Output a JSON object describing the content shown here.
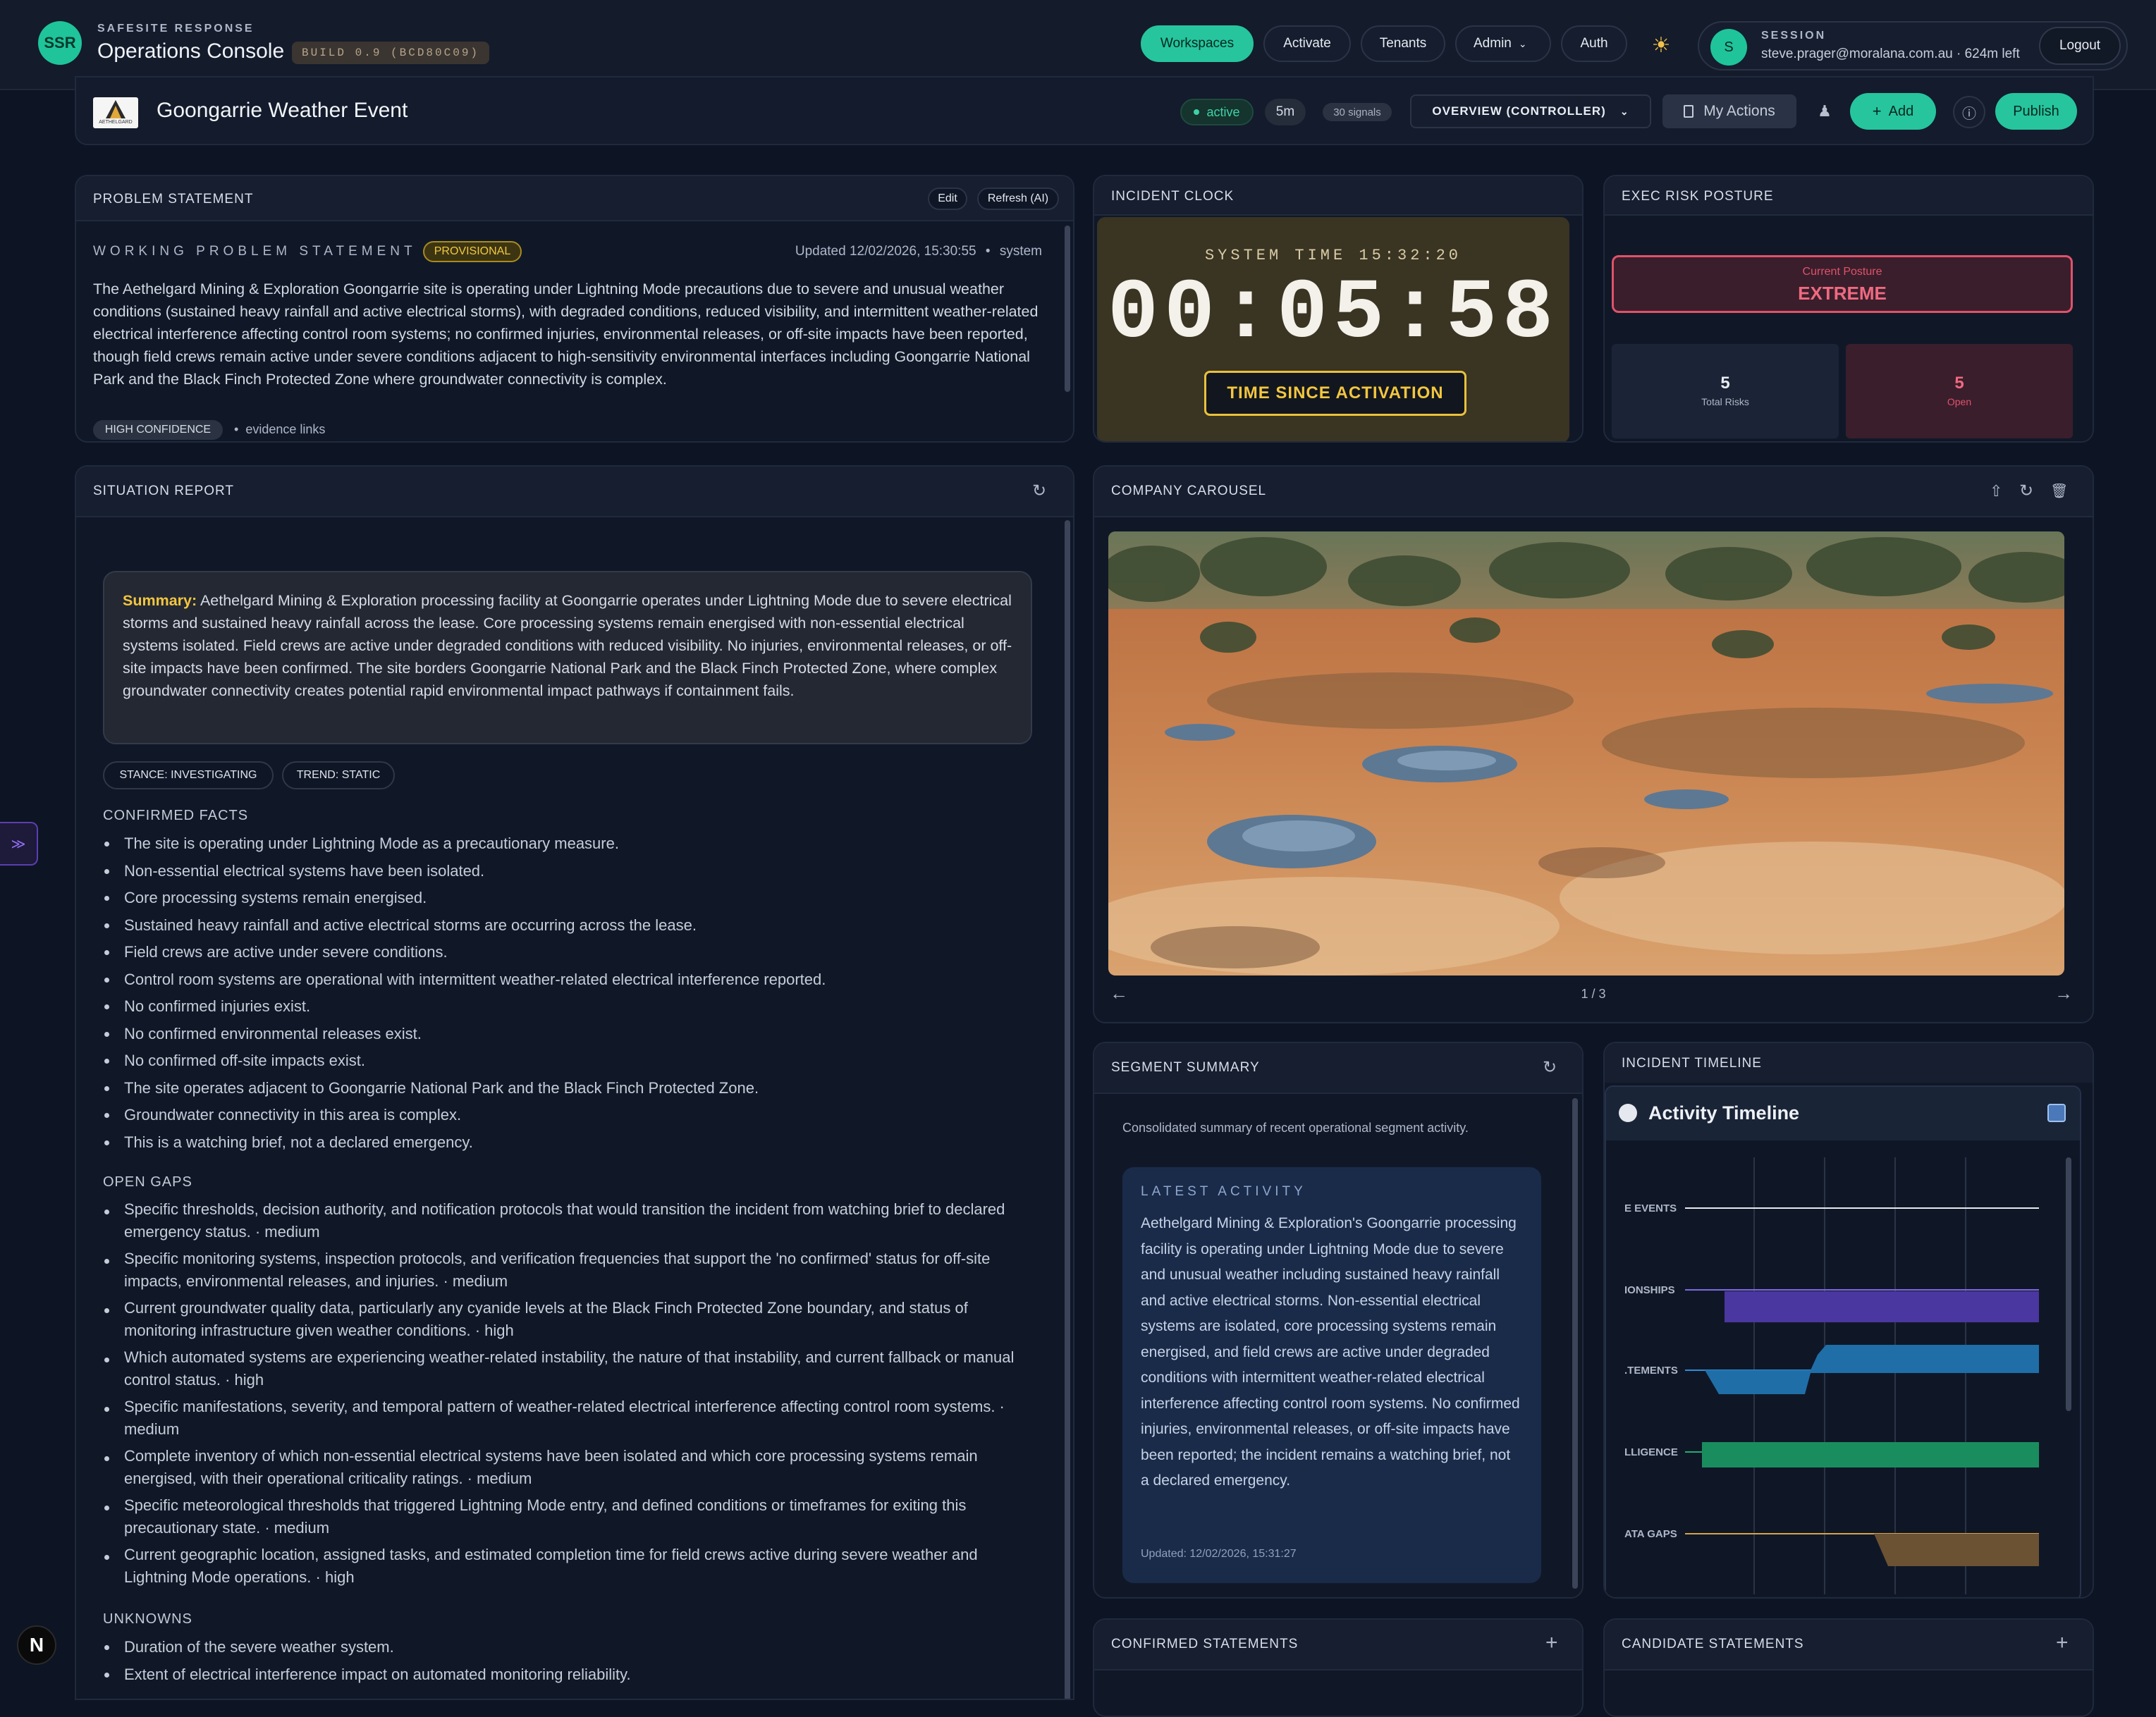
{
  "header": {
    "logo": "SSR",
    "subtitle": "SAFESITE RESPONSE",
    "title": "Operations Console",
    "build": "BUILD 0.9 (BCD80C09)",
    "nav": [
      "Workspaces",
      "Activate",
      "Tenants",
      "Admin",
      "Auth"
    ],
    "session_label": "SESSION",
    "session_user": "steve.prager@moralana.com.au · 624m left",
    "avatar": "S",
    "logout": "Logout"
  },
  "workspace": {
    "logo_text": "AETHELGARD",
    "title": "Goongarrie Weather Event",
    "status": "active",
    "duration": "5m",
    "signals": "30 signals",
    "view": "OVERVIEW (CONTROLLER)",
    "my_actions": "My Actions",
    "add": "Add",
    "publish": "Publish"
  },
  "problem": {
    "card_title": "PROBLEM STATEMENT",
    "edit": "Edit",
    "refresh": "Refresh (AI)",
    "heading": "WORKING PROBLEM STATEMENT",
    "badge": "PROVISIONAL",
    "updated": "Updated 12/02/2026, 15:30:55",
    "author": "system",
    "text": "The Aethelgard Mining & Exploration Goongarrie site is operating under Lightning Mode precautions due to severe and unusual weather conditions (sustained heavy rainfall and active electrical storms), with degraded conditions, reduced visibility, and intermittent weather-related electrical interference affecting control room systems; no confirmed injuries, environmental releases, or off-site impacts have been reported, though field crews remain active under severe conditions adjacent to high-sensitivity environmental interfaces including Goongarrie National Park and the Black Finch Protected Zone where groundwater connectivity is complex.",
    "confidence": "HIGH CONFIDENCE",
    "evidence": "evidence links"
  },
  "clock": {
    "card_title": "INCIDENT CLOCK",
    "system_time": "SYSTEM TIME 15:32:20",
    "elapsed": "00:05:58",
    "label": "TIME SINCE ACTIVATION"
  },
  "risk": {
    "card_title": "EXEC RISK POSTURE",
    "posture_label": "Current Posture",
    "posture": "EXTREME",
    "total": "5",
    "total_label": "Total Risks",
    "open": "5",
    "open_label": "Open"
  },
  "sitrep": {
    "card_title": "SITUATION REPORT",
    "summary_label": "Summary:",
    "summary": "Aethelgard Mining & Exploration processing facility at Goongarrie operates under Lightning Mode due to severe electrical storms and sustained heavy rainfall across the lease. Core processing systems remain energised with non-essential electrical systems isolated. Field crews are active under degraded conditions with reduced visibility. No injuries, environmental releases, or off-site impacts have been confirmed. The site borders Goongarrie National Park and the Black Finch Protected Zone, where complex groundwater connectivity creates potential rapid environmental impact pathways if containment fails.",
    "stance": "STANCE: INVESTIGATING",
    "trend": "TREND: STATIC",
    "facts_title": "CONFIRMED FACTS",
    "facts": [
      "The site is operating under Lightning Mode as a precautionary measure.",
      "Non-essential electrical systems have been isolated.",
      "Core processing systems remain energised.",
      "Sustained heavy rainfall and active electrical storms are occurring across the lease.",
      "Field crews are active under severe conditions.",
      "Control room systems are operational with intermittent weather-related electrical interference reported.",
      "No confirmed injuries exist.",
      "No confirmed environmental releases exist.",
      "No confirmed off-site impacts exist.",
      "The site operates adjacent to Goongarrie National Park and the Black Finch Protected Zone.",
      "Groundwater connectivity in this area is complex.",
      "This is a watching brief, not a declared emergency."
    ],
    "gaps_title": "OPEN GAPS",
    "gaps": [
      "Specific thresholds, decision authority, and notification protocols that would transition the incident from watching brief to declared emergency status. · medium",
      "Specific monitoring systems, inspection protocols, and verification frequencies that support the 'no confirmed' status for off-site impacts, environmental releases, and injuries. · medium",
      "Current groundwater quality data, particularly any cyanide levels at the Black Finch Protected Zone boundary, and status of monitoring infrastructure given weather conditions. · high",
      "Which automated systems are experiencing weather-related instability, the nature of that instability, and current fallback or manual control status. · high",
      "Specific manifestations, severity, and temporal pattern of weather-related electrical interference affecting control room systems. · medium",
      "Complete inventory of which non-essential electrical systems have been isolated and which core processing systems remain energised, with their operational criticality ratings. · medium",
      "Specific meteorological thresholds that triggered Lightning Mode entry, and defined conditions or timeframes for exiting this precautionary state. · medium",
      "Current geographic location, assigned tasks, and estimated completion time for field crews active during severe weather and Lightning Mode operations. · high"
    ],
    "unknowns_title": "UNKNOWNS",
    "unknowns": [
      "Duration of the severe weather system.",
      "Extent of electrical interference impact on automated monitoring reliability."
    ]
  },
  "carousel": {
    "card_title": "COMPANY CAROUSEL",
    "counter": "1 / 3"
  },
  "segment": {
    "card_title": "SEGMENT SUMMARY",
    "intro": "Consolidated summary of recent operational segment activity.",
    "latest_label": "LATEST ACTIVITY",
    "text": "Aethelgard Mining & Exploration's Goongarrie processing facility is operating under Lightning Mode due to severe and unusual weather including sustained heavy rainfall and active electrical storms. Non-essential electrical systems are isolated, core processing systems remain energised, and field crews are active under degraded conditions with intermittent weather-related electrical interference affecting control room systems. No confirmed injuries, environmental releases, or off-site impacts have been reported; the incident remains a watching brief, not a declared emergency.",
    "updated": "Updated: 12/02/2026, 15:31:27"
  },
  "timeline": {
    "card_title": "INCIDENT TIMELINE",
    "heading": "Activity Timeline",
    "rows": [
      "E EVENTS",
      "IONSHIPS",
      ".TEMENTS",
      "LLIGENCE",
      "ATA GAPS"
    ]
  },
  "confirmed": {
    "card_title": "CONFIRMED STATEMENTS"
  },
  "candidate": {
    "card_title": "CANDIDATE STATEMENTS"
  },
  "colors": {
    "accent": "#26c59e",
    "danger": "#e0526a",
    "warning": "#f3c63f",
    "panel": "#101828"
  }
}
